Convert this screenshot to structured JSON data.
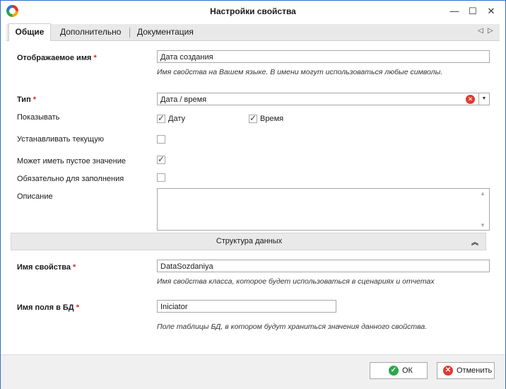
{
  "window": {
    "title": "Настройки свойства",
    "minimize_icon": "—",
    "maximize_icon": "☐",
    "close_icon": "✕"
  },
  "tabs": [
    {
      "label": "Общие",
      "active": true
    },
    {
      "label": "Дополнительно",
      "active": false
    },
    {
      "label": "Документация",
      "active": false
    }
  ],
  "tab_nav": {
    "prev": "◁",
    "next": "▷"
  },
  "form": {
    "display_name": {
      "label": "Отображаемое имя",
      "required_mark": "*",
      "value": "Дата создания",
      "hint": "Имя свойства на Вашем языке. В имени могут использоваться любые символы."
    },
    "type": {
      "label": "Тип",
      "required_mark": "*",
      "value": "Дата / время",
      "clear_icon": "✕",
      "dropdown_icon": "▼"
    },
    "show": {
      "label": "Показывать",
      "date_label": "Дату",
      "date_checked": true,
      "time_label": "Время",
      "time_checked": true
    },
    "set_current": {
      "label": "Устанавливать текущую",
      "checked": false
    },
    "can_be_empty": {
      "label": "Может иметь пустое значение",
      "checked": true
    },
    "required": {
      "label": "Обязательно для заполнения",
      "checked": false
    },
    "description": {
      "label": "Описание",
      "value": ""
    }
  },
  "data_structure": {
    "title": "Структура данных",
    "toggle_icon": "⌃",
    "property_name": {
      "label": "Имя свойства",
      "required_mark": "*",
      "value": "DataSozdaniya",
      "hint": "Имя свойства класса, которое будет использоваться в сценариях и отчетах"
    },
    "db_field": {
      "label": "Имя поля в БД",
      "required_mark": "*",
      "value": "Iniciator",
      "hint": "Поле таблицы БД, в котором будут храниться значения данного свойства."
    }
  },
  "footer": {
    "ok_label": "ОК",
    "ok_icon": "✓",
    "cancel_label": "Отменить",
    "cancel_icon": "✕"
  },
  "colors": {
    "accent_border": "#2b71c7",
    "required": "#d52b1e",
    "ok_icon": "#2aa84a",
    "cancel_icon": "#e03a2f"
  }
}
